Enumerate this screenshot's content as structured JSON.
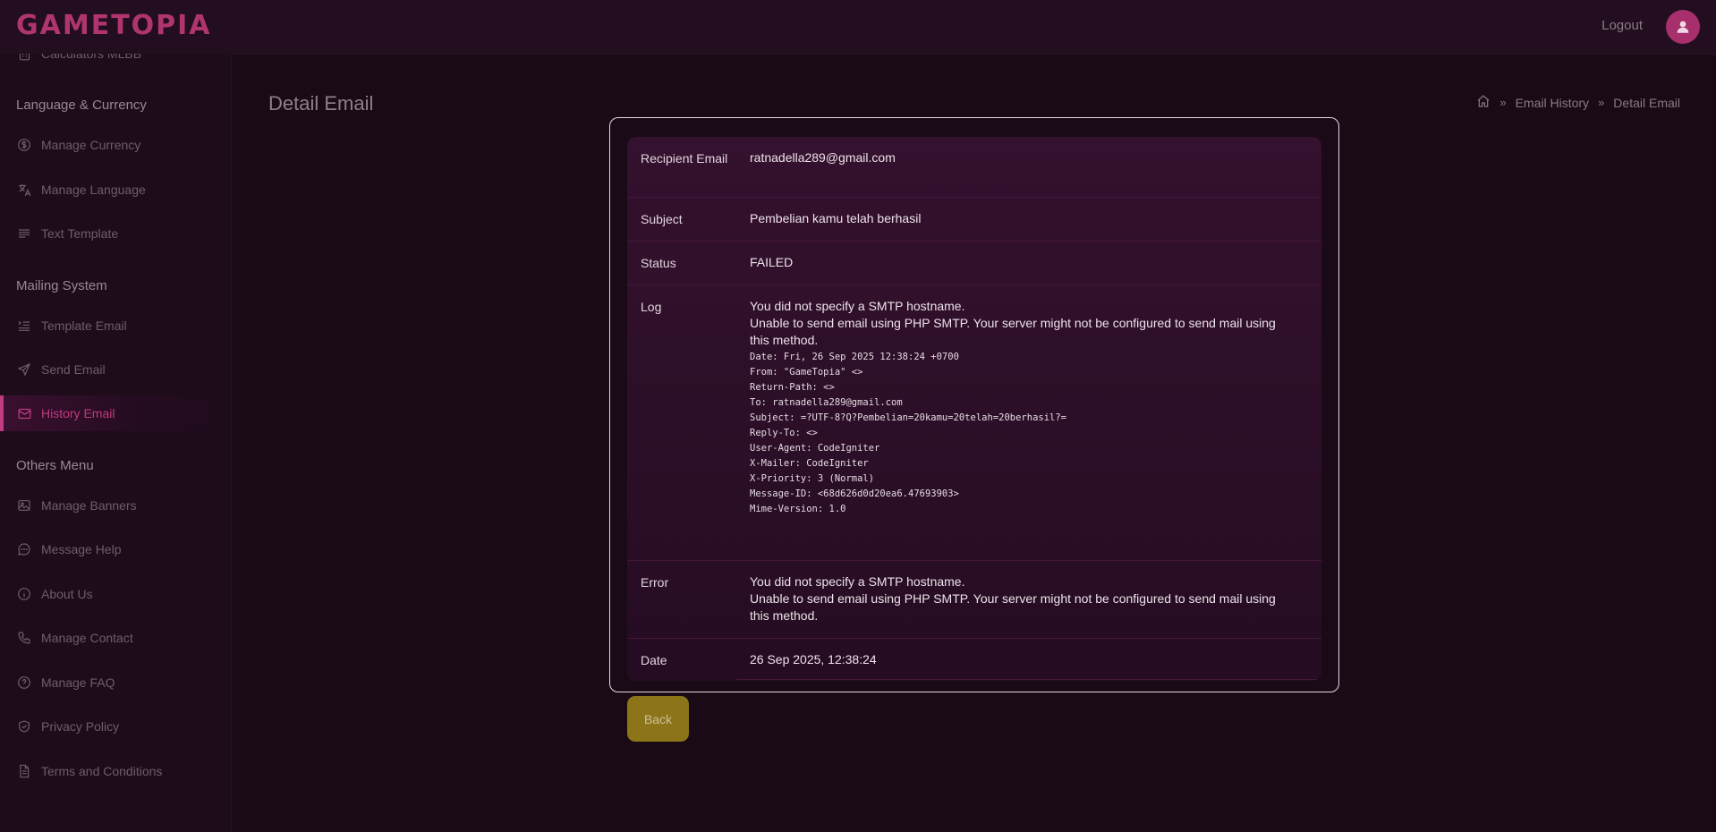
{
  "header": {
    "logo": "GAMETOPIA",
    "logout_label": "Logout"
  },
  "sidebar": {
    "top_item": "Calculators MLBB",
    "sections": [
      {
        "title": "Language & Currency",
        "items": [
          "Manage Currency",
          "Manage Language",
          "Text Template"
        ]
      },
      {
        "title": "Mailing System",
        "items": [
          "Template Email",
          "Send Email",
          "History Email"
        ]
      },
      {
        "title": "Others Menu",
        "items": [
          "Manage Banners",
          "Message Help",
          "About Us",
          "Manage Contact",
          "Manage FAQ",
          "Privacy Policy",
          "Terms and Conditions"
        ]
      }
    ],
    "active_item": "History Email"
  },
  "page": {
    "title": "Detail Email",
    "breadcrumb": [
      "Email History",
      "Detail Email"
    ]
  },
  "detail": {
    "recipient_label": "Recipient Email",
    "recipient_value": "ratnadella289@gmail.com",
    "subject_label": "Subject",
    "subject_value": "Pembelian kamu telah berhasil",
    "status_label": "Status",
    "status_value": "FAILED",
    "log_label": "Log",
    "log_line1": "You did not specify a SMTP hostname.",
    "log_line2": "Unable to send email using PHP SMTP. Your server might not be configured to send mail using this method.",
    "log_headers": [
      "Date: Fri, 26 Sep 2025 12:38:24 +0700",
      "From: \"GameTopia\" <>",
      "Return-Path: <>",
      "To: ratnadella289@gmail.com",
      "Subject: =?UTF-8?Q?Pembelian=20kamu=20telah=20berhasil?=",
      "Reply-To: <>",
      "User-Agent: CodeIgniter",
      "X-Mailer: CodeIgniter",
      "X-Priority: 3 (Normal)",
      "Message-ID: <68d626d0d20ea6.47693903>",
      "Mime-Version: 1.0"
    ],
    "error_label": "Error",
    "error_line1": "You did not specify a SMTP hostname.",
    "error_line2": "Unable to send email using PHP SMTP. Your server might not be configured to send mail using this method.",
    "date_label": "Date",
    "date_value": "26 Sep 2025, 12:38:24"
  },
  "actions": {
    "back_label": "Back"
  },
  "colors": {
    "accent": "#c03b7f",
    "background": "#190a16",
    "back_button": "#8c7418"
  }
}
